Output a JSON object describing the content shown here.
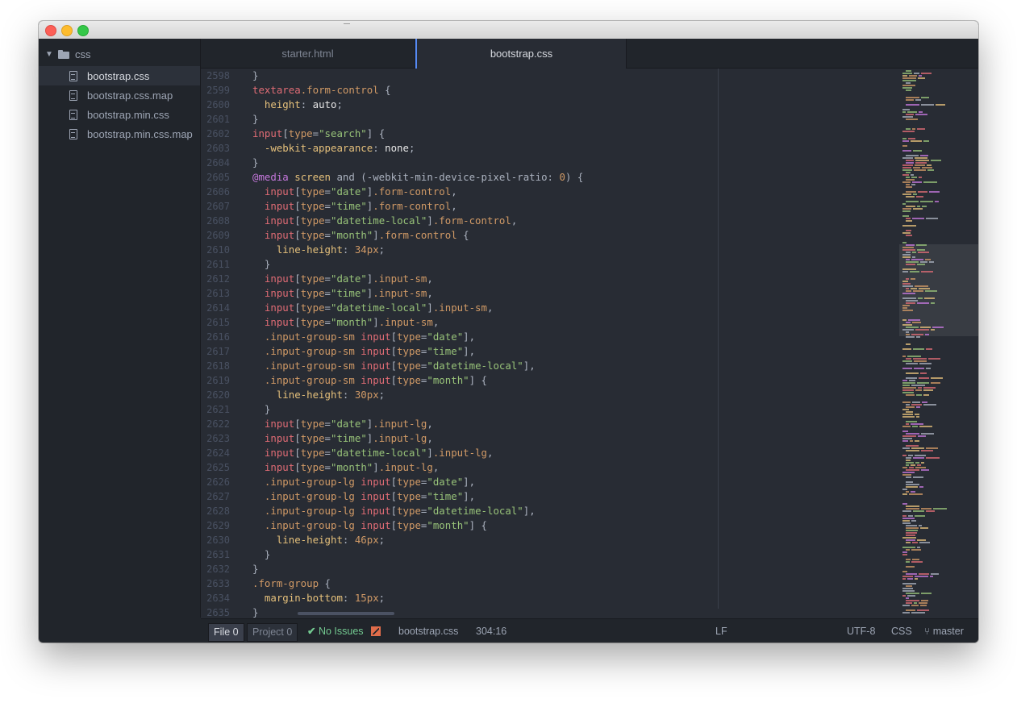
{
  "sidebar": {
    "root": {
      "label": "css",
      "expanded": true
    },
    "files": [
      {
        "label": "bootstrap.css",
        "selected": true
      },
      {
        "label": "bootstrap.css.map",
        "selected": false
      },
      {
        "label": "bootstrap.min.css",
        "selected": false
      },
      {
        "label": "bootstrap.min.css.map",
        "selected": false
      }
    ]
  },
  "tabs": [
    {
      "label": "starter.html",
      "active": false
    },
    {
      "label": "bootstrap.css",
      "active": true
    }
  ],
  "editor": {
    "lines": [
      {
        "n": "2598",
        "tokens": [
          [
            "p",
            "}"
          ]
        ]
      },
      {
        "n": "2599",
        "tokens": [
          [
            "s",
            "textarea"
          ],
          [
            "c",
            ".form-control"
          ],
          [
            "p",
            " {"
          ]
        ]
      },
      {
        "n": "2600",
        "tokens": [
          [
            "g",
            "  "
          ],
          [
            "k",
            "height"
          ],
          [
            "p",
            ": "
          ],
          [
            "b",
            "auto"
          ],
          [
            "p",
            ";"
          ]
        ]
      },
      {
        "n": "2601",
        "tokens": [
          [
            "p",
            "}"
          ]
        ]
      },
      {
        "n": "2602",
        "tokens": [
          [
            "s",
            "input"
          ],
          [
            "p",
            "["
          ],
          [
            "a",
            "type"
          ],
          [
            "p",
            "="
          ],
          [
            "t",
            "\"search\""
          ],
          [
            "p",
            "] {"
          ]
        ]
      },
      {
        "n": "2603",
        "tokens": [
          [
            "g",
            "  "
          ],
          [
            "k",
            "-webkit-appearance"
          ],
          [
            "p",
            ": "
          ],
          [
            "b",
            "none"
          ],
          [
            "p",
            ";"
          ]
        ]
      },
      {
        "n": "2604",
        "tokens": [
          [
            "p",
            "}"
          ]
        ]
      },
      {
        "n": "2605",
        "tokens": [
          [
            "w",
            "@media"
          ],
          [
            "p",
            " "
          ],
          [
            "k",
            "screen"
          ],
          [
            "p",
            " and (-webkit-min-device-pixel-ratio: "
          ],
          [
            "v",
            "0"
          ],
          [
            "p",
            ") {"
          ]
        ]
      },
      {
        "n": "2606",
        "tokens": [
          [
            "g",
            "  "
          ],
          [
            "s",
            "input"
          ],
          [
            "p",
            "["
          ],
          [
            "a",
            "type"
          ],
          [
            "p",
            "="
          ],
          [
            "t",
            "\"date\""
          ],
          [
            "p",
            "]"
          ],
          [
            "c",
            ".form-control"
          ],
          [
            "p",
            ","
          ]
        ]
      },
      {
        "n": "2607",
        "tokens": [
          [
            "g",
            "  "
          ],
          [
            "s",
            "input"
          ],
          [
            "p",
            "["
          ],
          [
            "a",
            "type"
          ],
          [
            "p",
            "="
          ],
          [
            "t",
            "\"time\""
          ],
          [
            "p",
            "]"
          ],
          [
            "c",
            ".form-control"
          ],
          [
            "p",
            ","
          ]
        ]
      },
      {
        "n": "2608",
        "tokens": [
          [
            "g",
            "  "
          ],
          [
            "s",
            "input"
          ],
          [
            "p",
            "["
          ],
          [
            "a",
            "type"
          ],
          [
            "p",
            "="
          ],
          [
            "t",
            "\"datetime-local\""
          ],
          [
            "p",
            "]"
          ],
          [
            "c",
            ".form-control"
          ],
          [
            "p",
            ","
          ]
        ]
      },
      {
        "n": "2609",
        "tokens": [
          [
            "g",
            "  "
          ],
          [
            "s",
            "input"
          ],
          [
            "p",
            "["
          ],
          [
            "a",
            "type"
          ],
          [
            "p",
            "="
          ],
          [
            "t",
            "\"month\""
          ],
          [
            "p",
            "]"
          ],
          [
            "c",
            ".form-control"
          ],
          [
            "p",
            " {"
          ]
        ]
      },
      {
        "n": "2610",
        "tokens": [
          [
            "g",
            "    "
          ],
          [
            "k",
            "line-height"
          ],
          [
            "p",
            ": "
          ],
          [
            "v",
            "34px"
          ],
          [
            "p",
            ";"
          ]
        ]
      },
      {
        "n": "2611",
        "tokens": [
          [
            "g",
            "  "
          ],
          [
            "p",
            "}"
          ]
        ]
      },
      {
        "n": "2612",
        "tokens": [
          [
            "g",
            "  "
          ],
          [
            "s",
            "input"
          ],
          [
            "p",
            "["
          ],
          [
            "a",
            "type"
          ],
          [
            "p",
            "="
          ],
          [
            "t",
            "\"date\""
          ],
          [
            "p",
            "]"
          ],
          [
            "c",
            ".input-sm"
          ],
          [
            "p",
            ","
          ]
        ]
      },
      {
        "n": "2613",
        "tokens": [
          [
            "g",
            "  "
          ],
          [
            "s",
            "input"
          ],
          [
            "p",
            "["
          ],
          [
            "a",
            "type"
          ],
          [
            "p",
            "="
          ],
          [
            "t",
            "\"time\""
          ],
          [
            "p",
            "]"
          ],
          [
            "c",
            ".input-sm"
          ],
          [
            "p",
            ","
          ]
        ]
      },
      {
        "n": "2614",
        "tokens": [
          [
            "g",
            "  "
          ],
          [
            "s",
            "input"
          ],
          [
            "p",
            "["
          ],
          [
            "a",
            "type"
          ],
          [
            "p",
            "="
          ],
          [
            "t",
            "\"datetime-local\""
          ],
          [
            "p",
            "]"
          ],
          [
            "c",
            ".input-sm"
          ],
          [
            "p",
            ","
          ]
        ]
      },
      {
        "n": "2615",
        "tokens": [
          [
            "g",
            "  "
          ],
          [
            "s",
            "input"
          ],
          [
            "p",
            "["
          ],
          [
            "a",
            "type"
          ],
          [
            "p",
            "="
          ],
          [
            "t",
            "\"month\""
          ],
          [
            "p",
            "]"
          ],
          [
            "c",
            ".input-sm"
          ],
          [
            "p",
            ","
          ]
        ]
      },
      {
        "n": "2616",
        "tokens": [
          [
            "g",
            "  "
          ],
          [
            "c",
            ".input-group-sm"
          ],
          [
            "p",
            " "
          ],
          [
            "s",
            "input"
          ],
          [
            "p",
            "["
          ],
          [
            "a",
            "type"
          ],
          [
            "p",
            "="
          ],
          [
            "t",
            "\"date\""
          ],
          [
            "p",
            "],"
          ]
        ]
      },
      {
        "n": "2617",
        "tokens": [
          [
            "g",
            "  "
          ],
          [
            "c",
            ".input-group-sm"
          ],
          [
            "p",
            " "
          ],
          [
            "s",
            "input"
          ],
          [
            "p",
            "["
          ],
          [
            "a",
            "type"
          ],
          [
            "p",
            "="
          ],
          [
            "t",
            "\"time\""
          ],
          [
            "p",
            "],"
          ]
        ]
      },
      {
        "n": "2618",
        "tokens": [
          [
            "g",
            "  "
          ],
          [
            "c",
            ".input-group-sm"
          ],
          [
            "p",
            " "
          ],
          [
            "s",
            "input"
          ],
          [
            "p",
            "["
          ],
          [
            "a",
            "type"
          ],
          [
            "p",
            "="
          ],
          [
            "t",
            "\"datetime-local\""
          ],
          [
            "p",
            "],"
          ]
        ]
      },
      {
        "n": "2619",
        "tokens": [
          [
            "g",
            "  "
          ],
          [
            "c",
            ".input-group-sm"
          ],
          [
            "p",
            " "
          ],
          [
            "s",
            "input"
          ],
          [
            "p",
            "["
          ],
          [
            "a",
            "type"
          ],
          [
            "p",
            "="
          ],
          [
            "t",
            "\"month\""
          ],
          [
            "p",
            "] {"
          ]
        ]
      },
      {
        "n": "2620",
        "tokens": [
          [
            "g",
            "    "
          ],
          [
            "k",
            "line-height"
          ],
          [
            "p",
            ": "
          ],
          [
            "v",
            "30px"
          ],
          [
            "p",
            ";"
          ]
        ]
      },
      {
        "n": "2621",
        "tokens": [
          [
            "g",
            "  "
          ],
          [
            "p",
            "}"
          ]
        ]
      },
      {
        "n": "2622",
        "tokens": [
          [
            "g",
            "  "
          ],
          [
            "s",
            "input"
          ],
          [
            "p",
            "["
          ],
          [
            "a",
            "type"
          ],
          [
            "p",
            "="
          ],
          [
            "t",
            "\"date\""
          ],
          [
            "p",
            "]"
          ],
          [
            "c",
            ".input-lg"
          ],
          [
            "p",
            ","
          ]
        ]
      },
      {
        "n": "2623",
        "tokens": [
          [
            "g",
            "  "
          ],
          [
            "s",
            "input"
          ],
          [
            "p",
            "["
          ],
          [
            "a",
            "type"
          ],
          [
            "p",
            "="
          ],
          [
            "t",
            "\"time\""
          ],
          [
            "p",
            "]"
          ],
          [
            "c",
            ".input-lg"
          ],
          [
            "p",
            ","
          ]
        ]
      },
      {
        "n": "2624",
        "tokens": [
          [
            "g",
            "  "
          ],
          [
            "s",
            "input"
          ],
          [
            "p",
            "["
          ],
          [
            "a",
            "type"
          ],
          [
            "p",
            "="
          ],
          [
            "t",
            "\"datetime-local\""
          ],
          [
            "p",
            "]"
          ],
          [
            "c",
            ".input-lg"
          ],
          [
            "p",
            ","
          ]
        ]
      },
      {
        "n": "2625",
        "tokens": [
          [
            "g",
            "  "
          ],
          [
            "s",
            "input"
          ],
          [
            "p",
            "["
          ],
          [
            "a",
            "type"
          ],
          [
            "p",
            "="
          ],
          [
            "t",
            "\"month\""
          ],
          [
            "p",
            "]"
          ],
          [
            "c",
            ".input-lg"
          ],
          [
            "p",
            ","
          ]
        ]
      },
      {
        "n": "2626",
        "tokens": [
          [
            "g",
            "  "
          ],
          [
            "c",
            ".input-group-lg"
          ],
          [
            "p",
            " "
          ],
          [
            "s",
            "input"
          ],
          [
            "p",
            "["
          ],
          [
            "a",
            "type"
          ],
          [
            "p",
            "="
          ],
          [
            "t",
            "\"date\""
          ],
          [
            "p",
            "],"
          ]
        ]
      },
      {
        "n": "2627",
        "tokens": [
          [
            "g",
            "  "
          ],
          [
            "c",
            ".input-group-lg"
          ],
          [
            "p",
            " "
          ],
          [
            "s",
            "input"
          ],
          [
            "p",
            "["
          ],
          [
            "a",
            "type"
          ],
          [
            "p",
            "="
          ],
          [
            "t",
            "\"time\""
          ],
          [
            "p",
            "],"
          ]
        ]
      },
      {
        "n": "2628",
        "tokens": [
          [
            "g",
            "  "
          ],
          [
            "c",
            ".input-group-lg"
          ],
          [
            "p",
            " "
          ],
          [
            "s",
            "input"
          ],
          [
            "p",
            "["
          ],
          [
            "a",
            "type"
          ],
          [
            "p",
            "="
          ],
          [
            "t",
            "\"datetime-local\""
          ],
          [
            "p",
            "],"
          ]
        ]
      },
      {
        "n": "2629",
        "tokens": [
          [
            "g",
            "  "
          ],
          [
            "c",
            ".input-group-lg"
          ],
          [
            "p",
            " "
          ],
          [
            "s",
            "input"
          ],
          [
            "p",
            "["
          ],
          [
            "a",
            "type"
          ],
          [
            "p",
            "="
          ],
          [
            "t",
            "\"month\""
          ],
          [
            "p",
            "] {"
          ]
        ]
      },
      {
        "n": "2630",
        "tokens": [
          [
            "g",
            "    "
          ],
          [
            "k",
            "line-height"
          ],
          [
            "p",
            ": "
          ],
          [
            "v",
            "46px"
          ],
          [
            "p",
            ";"
          ]
        ]
      },
      {
        "n": "2631",
        "tokens": [
          [
            "g",
            "  "
          ],
          [
            "p",
            "}"
          ]
        ]
      },
      {
        "n": "2632",
        "tokens": [
          [
            "p",
            "}"
          ]
        ]
      },
      {
        "n": "2633",
        "tokens": [
          [
            "c",
            ".form-group"
          ],
          [
            "p",
            " {"
          ]
        ]
      },
      {
        "n": "2634",
        "tokens": [
          [
            "g",
            "  "
          ],
          [
            "k",
            "margin-bottom"
          ],
          [
            "p",
            ": "
          ],
          [
            "v",
            "15px"
          ],
          [
            "p",
            ";"
          ]
        ]
      },
      {
        "n": "2635",
        "tokens": [
          [
            "p",
            "}"
          ]
        ]
      }
    ]
  },
  "statusbar": {
    "file_tab": {
      "label": "File",
      "count": "0"
    },
    "project_tab": {
      "label": "Project",
      "count": "0"
    },
    "issues": {
      "check": "✔",
      "label": "No Issues"
    },
    "filename": "bootstrap.css",
    "cursor": "304:16",
    "line_ending": "LF",
    "encoding": "UTF-8",
    "grammar": "CSS",
    "branch": "master"
  },
  "colors": {
    "background": "#282c34",
    "panel": "#21252b",
    "accent": "#568af2",
    "selector": "#e06c75",
    "class": "#d19a66",
    "string": "#98c379",
    "property": "#e5c07b",
    "keyword": "#c678dd",
    "ok": "#73c990"
  },
  "icons": [
    "chevron-down-icon",
    "folder-icon",
    "file-text-icon",
    "check-icon",
    "linter-icon",
    "git-branch-icon"
  ]
}
